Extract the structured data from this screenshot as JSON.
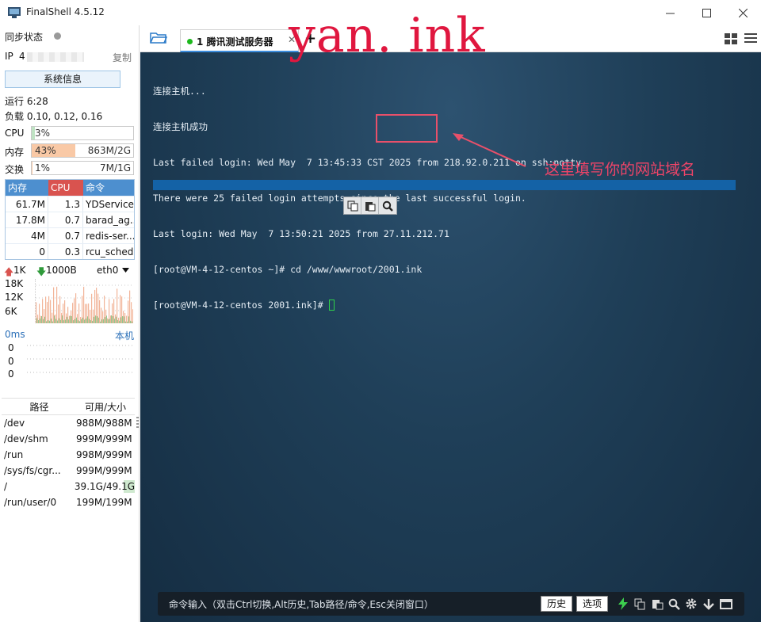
{
  "app": {
    "title": "FinalShell 4.5.12"
  },
  "watermark": "yan. ink",
  "sidebar": {
    "sync_status": "同步状态",
    "ip_label": "IP",
    "ip_value": "4",
    "copy_label": "复制",
    "sysinfo_button": "系统信息",
    "uptime": "运行 6:28",
    "load": "负载 0.10, 0.12, 0.16",
    "cpu": {
      "label": "CPU",
      "text": "3%",
      "percent": 3
    },
    "mem": {
      "label": "内存",
      "text": "43%",
      "detail": "863M/2G",
      "percent": 43
    },
    "swap": {
      "label": "交换",
      "text": "1%",
      "detail": "7M/1G",
      "percent": 1
    },
    "process_table": {
      "headers": [
        "内存",
        "CPU",
        "命令"
      ],
      "rows": [
        {
          "mem": "61.7M",
          "cpu": "1.3",
          "cmd": "YDService"
        },
        {
          "mem": "17.8M",
          "cpu": "0.7",
          "cmd": "barad_ag..."
        },
        {
          "mem": "4M",
          "cpu": "0.7",
          "cmd": "redis-ser..."
        },
        {
          "mem": "0",
          "cpu": "0.3",
          "cmd": "rcu_sched"
        }
      ]
    },
    "network": {
      "upload": "1K",
      "download": "1000B",
      "interface": "eth0",
      "y_ticks": [
        "18K",
        "12K",
        "6K"
      ]
    },
    "ping": {
      "latency": "0ms",
      "host": "本机",
      "values": [
        "0",
        "0",
        "0"
      ]
    },
    "disk_table": {
      "headers": [
        "路径",
        "可用/大小"
      ],
      "rows": [
        {
          "path": "/dev",
          "size": "988M/988M",
          "used": 0
        },
        {
          "path": "/dev/shm",
          "size": "999M/999M",
          "used": 0
        },
        {
          "path": "/run",
          "size": "998M/999M",
          "used": 0.001
        },
        {
          "path": "/sys/fs/cgr...",
          "size": "999M/999M",
          "used": 0
        },
        {
          "path": "/",
          "size": "39.1G/49.1G",
          "used": 0.2
        },
        {
          "path": "/run/user/0",
          "size": "199M/199M",
          "used": 0
        }
      ]
    }
  },
  "tabs": [
    {
      "label": "1 腾讯测试服务器",
      "active": true
    }
  ],
  "terminal": {
    "lines": [
      "连接主机...",
      "连接主机成功",
      "Last failed login: Wed May  7 13:45:33 CST 2025 from 218.92.0.211 on ssh:notty",
      "There were 25 failed login attempts since the last successful login.",
      "Last login: Wed May  7 13:50:21 2025 from 27.11.212.71",
      "[root@VM-4-12-centos ~]# cd /www/wwwroot/2001.ink",
      "[root@VM-4-12-centos 2001.ink]# "
    ],
    "annotation": "这里填写你的网站域名",
    "command_placeholder": "命令输入（双击Ctrl切换,Alt历史,Tab路径/命令,Esc关闭窗口）",
    "history_button": "历史",
    "options_button": "选项"
  },
  "colors": {
    "accent": "#4d8fcf",
    "mem_fill": "#f9c9a6",
    "cpu_fill": "#bfe3c3",
    "annotation": "#f04468",
    "watermark": "#e0173f",
    "cursor": "#2fd24a"
  }
}
